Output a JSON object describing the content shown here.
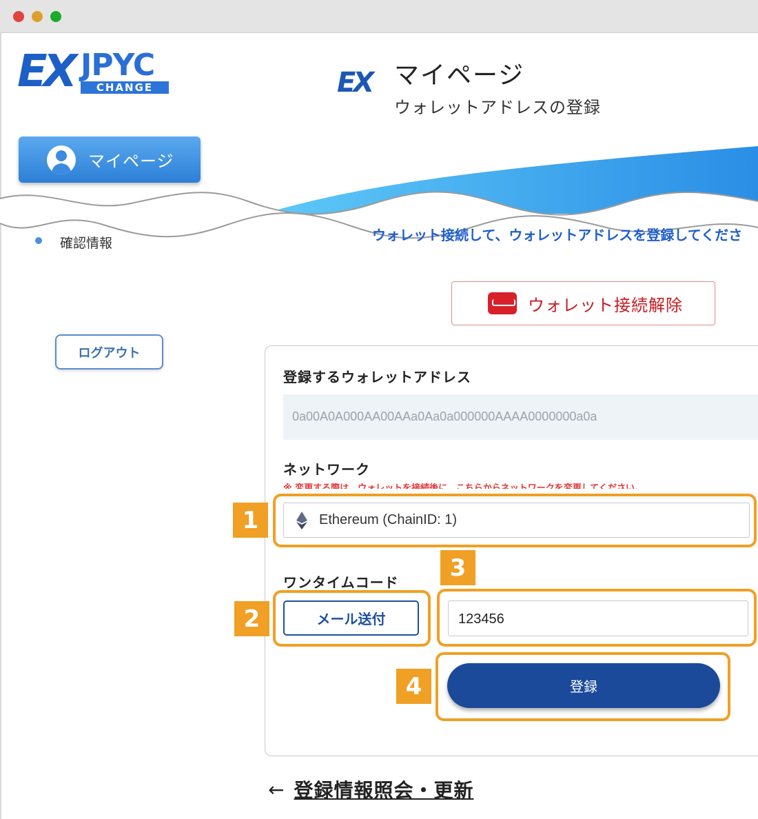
{
  "window": {
    "controls": [
      "close",
      "minimize",
      "maximize"
    ]
  },
  "logo": {
    "ex": "EX",
    "jpyc": "JPYC",
    "change": "CHANGE"
  },
  "sidebar": {
    "mypage_label": "マイページ",
    "nav_item": "確認情報",
    "logout_label": "ログアウト"
  },
  "header": {
    "ex_mark": "EX",
    "title": "マイページ",
    "subtitle": "ウォレットアドレスの登録"
  },
  "main": {
    "instruction": "ウォレット接続して、ウォレットアドレスを登録してくださ",
    "disconnect_label": "ウォレット接続解除",
    "form": {
      "address_label": "登録するウォレットアドレス",
      "address_value": "0a00A0A000AA00AAa0Aa0a000000AAAA0000000a0a",
      "network_label": "ネットワーク",
      "network_warning": "※ 変更する際は、ウォレットを接続後に、こちらからネットワークを変更してください。",
      "network_value": "Ethereum (ChainID: 1)",
      "otp_label": "ワンタイムコード",
      "mail_button": "メール送付",
      "otp_value": "123456",
      "register_button": "登録"
    },
    "back_link": "登録情報照会・更新",
    "back_arrow": "←"
  },
  "annotations": {
    "badges": [
      "1",
      "2",
      "3",
      "4"
    ],
    "color": "#f0a025"
  },
  "colors": {
    "primary": "#1b4a9b",
    "accent": "#2c7fd6",
    "danger": "#c8191f"
  }
}
